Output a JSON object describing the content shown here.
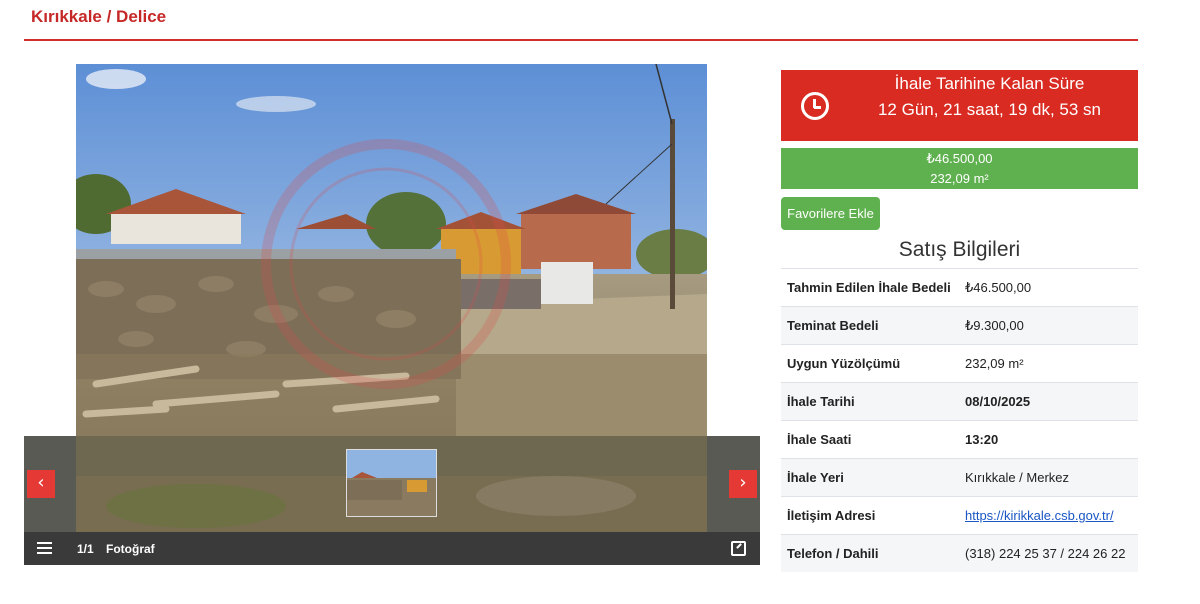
{
  "header": {
    "location": "Kırıkkale / Delice"
  },
  "gallery": {
    "counter": "1/1",
    "label": "Fotoğraf",
    "prev_arrow": "‹",
    "next_arrow": "›",
    "icons": {
      "list": "list-icon",
      "expand": "expand-icon"
    }
  },
  "countdown": {
    "title": "İhale Tarihine Kalan Süre",
    "value": "12 Gün, 21 saat, 19 dk, 53 sn",
    "color": "#d92b22"
  },
  "price": {
    "amount": "₺46.500,00",
    "area": "232,09 m²",
    "color": "#5fb04e"
  },
  "favorite_button": "Favorilere Ekle",
  "sales": {
    "title": "Satış Bilgileri",
    "rows": [
      {
        "label": "Tahmin Edilen İhale Bedeli",
        "value": "₺46.500,00"
      },
      {
        "label": "Teminat Bedeli",
        "value": "₺9.300,00"
      },
      {
        "label": "Uygun Yüzölçümü",
        "value": "232,09 m²"
      },
      {
        "label": "İhale Tarihi",
        "value": "08/10/2025"
      },
      {
        "label": "İhale Saati",
        "value": "13:20"
      },
      {
        "label": "İhale Yeri",
        "value": "Kırıkkale / Merkez"
      },
      {
        "label": "İletişim Adresi",
        "value": "https://kirikkale.csb.gov.tr/"
      },
      {
        "label": "Telefon / Dahili",
        "value": "(318) 224 25 37 / 224 26 22"
      }
    ]
  }
}
